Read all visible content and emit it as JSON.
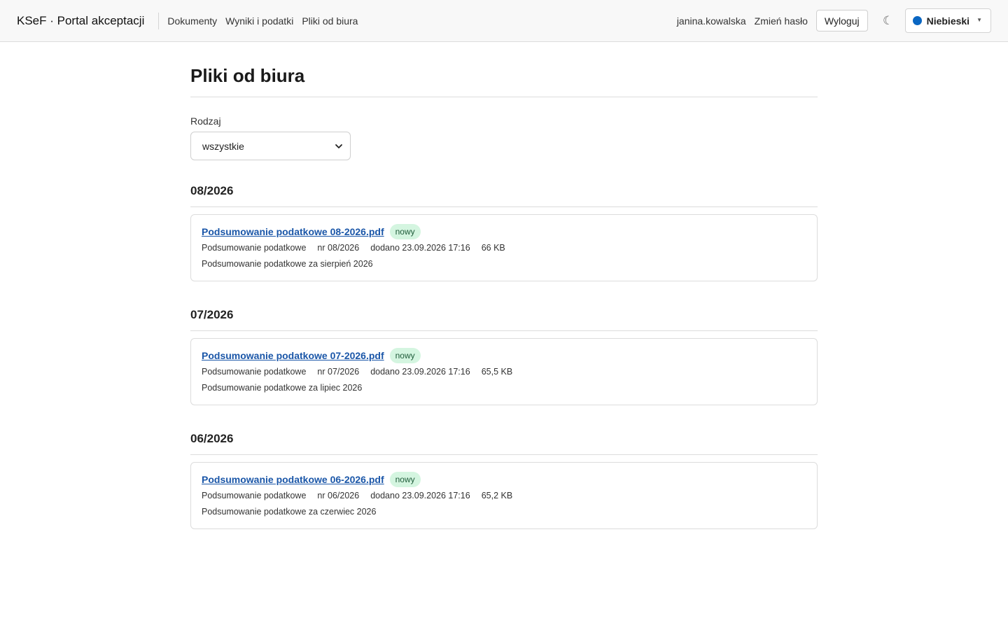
{
  "header": {
    "brand": "KSeF · Portal akceptacji",
    "nav": [
      "Dokumenty",
      "Wyniki i podatki",
      "Pliki od biura"
    ],
    "user": "janina.kowalska",
    "change_password": "Zmień hasło",
    "logout": "Wyloguj",
    "theme_toggle_icon": "☾",
    "theme": {
      "label": "Niebieski",
      "color": "#0a66c2"
    }
  },
  "page": {
    "title": "Pliki od biura",
    "filter": {
      "label": "Rodzaj",
      "value": "wszystkie"
    }
  },
  "groups": [
    {
      "title": "08/2026",
      "files": [
        {
          "name": "Podsumowanie podatkowe 08-2026.pdf",
          "badge": "nowy",
          "type": "Podsumowanie podatkowe",
          "number": "nr 08/2026",
          "added": "dodano 23.09.2026 17:16",
          "size": "66 KB",
          "description": "Podsumowanie podatkowe za sierpień 2026"
        }
      ]
    },
    {
      "title": "07/2026",
      "files": [
        {
          "name": "Podsumowanie podatkowe 07-2026.pdf",
          "badge": "nowy",
          "type": "Podsumowanie podatkowe",
          "number": "nr 07/2026",
          "added": "dodano 23.09.2026 17:16",
          "size": "65,5 KB",
          "description": "Podsumowanie podatkowe za lipiec 2026"
        }
      ]
    },
    {
      "title": "06/2026",
      "files": [
        {
          "name": "Podsumowanie podatkowe 06-2026.pdf",
          "badge": "nowy",
          "type": "Podsumowanie podatkowe",
          "number": "nr 06/2026",
          "added": "dodano 23.09.2026 17:16",
          "size": "65,2 KB",
          "description": "Podsumowanie podatkowe za czerwiec 2026"
        }
      ]
    }
  ]
}
